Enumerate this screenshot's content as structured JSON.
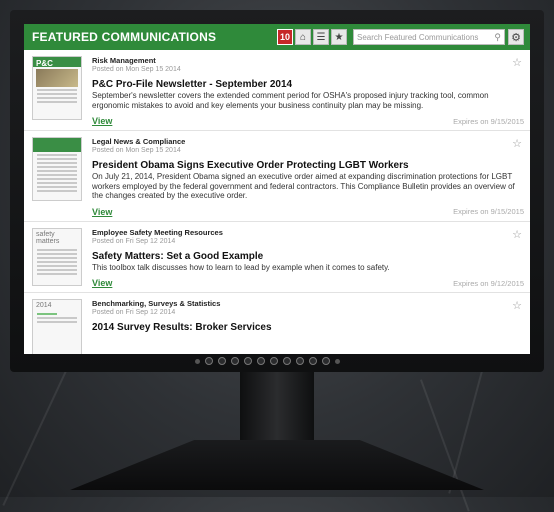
{
  "header": {
    "title": "FEATURED COMMUNICATIONS",
    "badge_count": "10",
    "home_icon": "home-icon",
    "list_icon": "list-icon",
    "star_icon": "star-icon",
    "search_placeholder": "Search Featured Communications",
    "search_icon": "search-icon",
    "settings_icon": "gear-icon"
  },
  "items": [
    {
      "category": "Risk Management",
      "posted": "Posted on Mon Sep 15 2014",
      "title": "P&C Pro-File Newsletter - September 2014",
      "description": "September's newsletter covers the extended comment period for OSHA's proposed injury tracking tool, common ergonomic mistakes to avoid and key elements your business continuity plan may be missing.",
      "view_label": "View",
      "expires": "Expires on 9/15/2015",
      "thumb_text": "P&C"
    },
    {
      "category": "Legal News & Compliance",
      "posted": "Posted on Mon Sep 15 2014",
      "title": "President Obama Signs Executive Order Protecting LGBT Workers",
      "description": "On July 21, 2014, President Obama signed an executive order aimed at expanding discrimination protections for LGBT workers employed by the federal government and federal contractors. This Compliance Bulletin provides an overview of the changes created by the executive order.",
      "view_label": "View",
      "expires": "Expires on 9/15/2015",
      "thumb_text": ""
    },
    {
      "category": "Employee Safety Meeting Resources",
      "posted": "Posted on Fri Sep 12 2014",
      "title": "Safety Matters: Set a Good Example",
      "description": "This toolbox talk discusses how to learn to lead by example when it comes to safety.",
      "view_label": "View",
      "expires": "Expires on 9/12/2015",
      "thumb_text": "safety matters"
    },
    {
      "category": "Benchmarking, Surveys & Statistics",
      "posted": "Posted on Fri Sep 12 2014",
      "title": "2014 Survey Results: Broker Services",
      "description": "",
      "view_label": "",
      "expires": "",
      "thumb_text": "2014"
    }
  ],
  "colors": {
    "accent": "#2f8a3a",
    "badge": "#c62828"
  }
}
